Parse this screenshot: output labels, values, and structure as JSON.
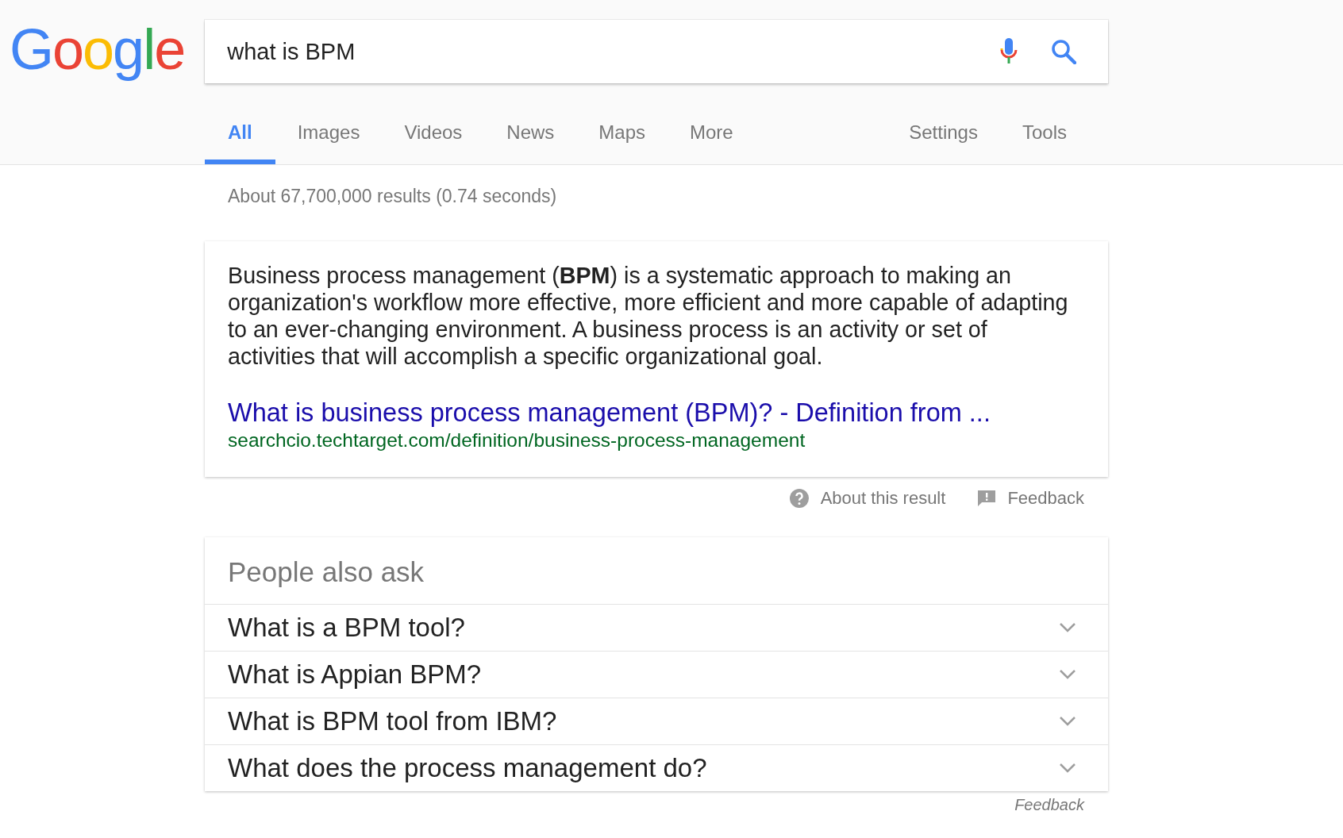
{
  "logo": "Google",
  "search": {
    "value": "what is BPM"
  },
  "tabs": [
    {
      "label": "All",
      "selected": true
    },
    {
      "label": "Images",
      "selected": false
    },
    {
      "label": "Videos",
      "selected": false
    },
    {
      "label": "News",
      "selected": false
    },
    {
      "label": "Maps",
      "selected": false
    },
    {
      "label": "More",
      "selected": false
    }
  ],
  "right_tabs": [
    {
      "label": "Settings",
      "selected": false
    },
    {
      "label": "Tools",
      "selected": false
    }
  ],
  "result_stats": "About 67,700,000 results (0.74 seconds)",
  "featured_snippet": {
    "text": "Business process management (**BPM**) is a systematic approach to making an organization's workflow more effective, more efficient and more capable of adapting to an ever-changing environment. A business process is an activity or set of activities that will accomplish a specific organizational goal.",
    "link_title": "What is business process management (BPM)? - Definition from ...",
    "url": "searchcio.techtarget.com/definition/business-process-management"
  },
  "snippet_footer": {
    "about": "About this result",
    "feedback": "Feedback"
  },
  "people_also_ask": {
    "title": "People also ask",
    "questions": [
      {
        "text": "What is a BPM tool?",
        "expanded": false
      },
      {
        "text": "What is Appian BPM?",
        "expanded": false
      },
      {
        "text": "What is BPM tool from IBM?",
        "expanded": false
      },
      {
        "text": "What does the process management do?",
        "expanded": false
      }
    ],
    "feedback": "Feedback"
  }
}
